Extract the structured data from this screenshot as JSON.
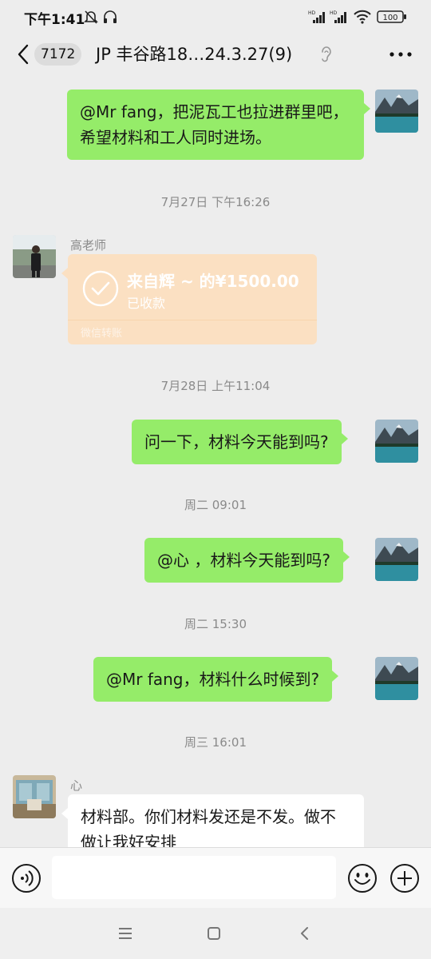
{
  "status_bar": {
    "time": "下午1:41",
    "battery": "100",
    "icons": [
      "alarm-off-icon",
      "headset-icon",
      "hd-signal-icon",
      "hd-signal-icon",
      "wifi-icon",
      "battery-icon"
    ]
  },
  "header": {
    "unread_count": "7172",
    "title": "JP 丰谷路18…24.3.27(9)",
    "icons": [
      "back-chevron-icon",
      "ear-icon",
      "more-dots-icon"
    ]
  },
  "messages": [
    {
      "type": "text",
      "from": "me",
      "text": "@Mr  fang，把泥瓦工也拉进群里吧，希望材料和工人同时进场。"
    },
    {
      "type": "timestamp",
      "text": "7月27日 下午16:26"
    },
    {
      "type": "transfer",
      "from": "other",
      "sender": "高老师",
      "amount_text": "来自辉 ~ 的¥1500.00",
      "status": "已收款",
      "footer": "微信转账"
    },
    {
      "type": "timestamp",
      "text": "7月28日 上午11:04"
    },
    {
      "type": "text",
      "from": "me",
      "text": "问一下，材料今天能到吗?"
    },
    {
      "type": "timestamp",
      "text": "周二 09:01"
    },
    {
      "type": "text",
      "from": "me",
      "text": "@心 ，材料今天能到吗?"
    },
    {
      "type": "timestamp",
      "text": "周二 15:30"
    },
    {
      "type": "text",
      "from": "me",
      "text": "@Mr  fang，材料什么时候到?"
    },
    {
      "type": "timestamp",
      "text": "周三 16:01"
    },
    {
      "type": "text",
      "from": "other",
      "sender": "心",
      "text": "材料部。你们材料发还是不发。做不做让我好安排"
    }
  ],
  "input_bar": {
    "placeholder": "",
    "icons": [
      "voice-icon",
      "emoji-icon",
      "plus-icon"
    ]
  },
  "nav_bar": {
    "icons": [
      "menu-icon",
      "home-icon",
      "back-icon"
    ]
  },
  "colors": {
    "background": "#ededed",
    "my_bubble": "#95ec69",
    "other_bubble": "#ffffff",
    "transfer_card": "#fbe0c2",
    "timestamp_text": "#8a8a8a"
  }
}
